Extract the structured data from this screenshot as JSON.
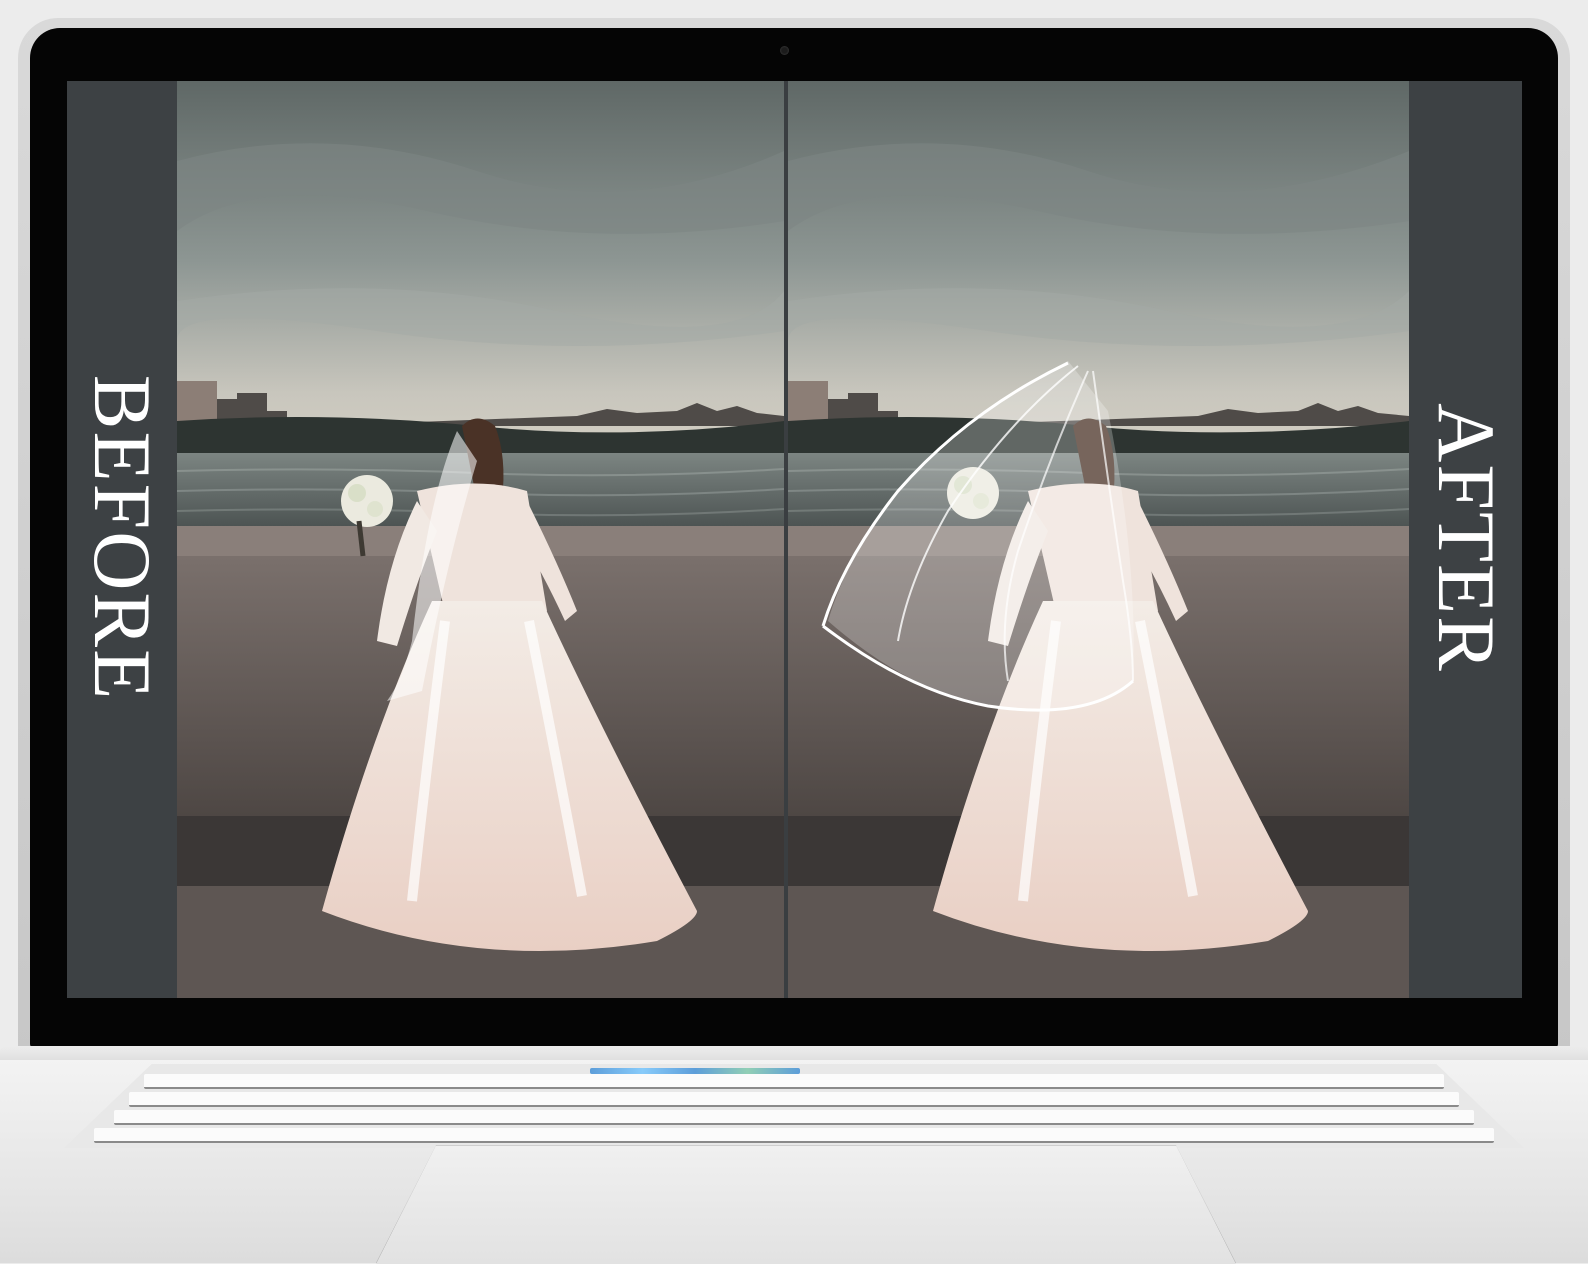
{
  "labels": {
    "before": "BEFORE",
    "after": "AFTER"
  },
  "colors": {
    "background": "#ececec",
    "panel": "#3d4144",
    "label": "#ffffff",
    "bezel": "#050505",
    "laptop_shell": "#d9d9d9"
  },
  "icons": {
    "camera": "webcam-dot"
  }
}
